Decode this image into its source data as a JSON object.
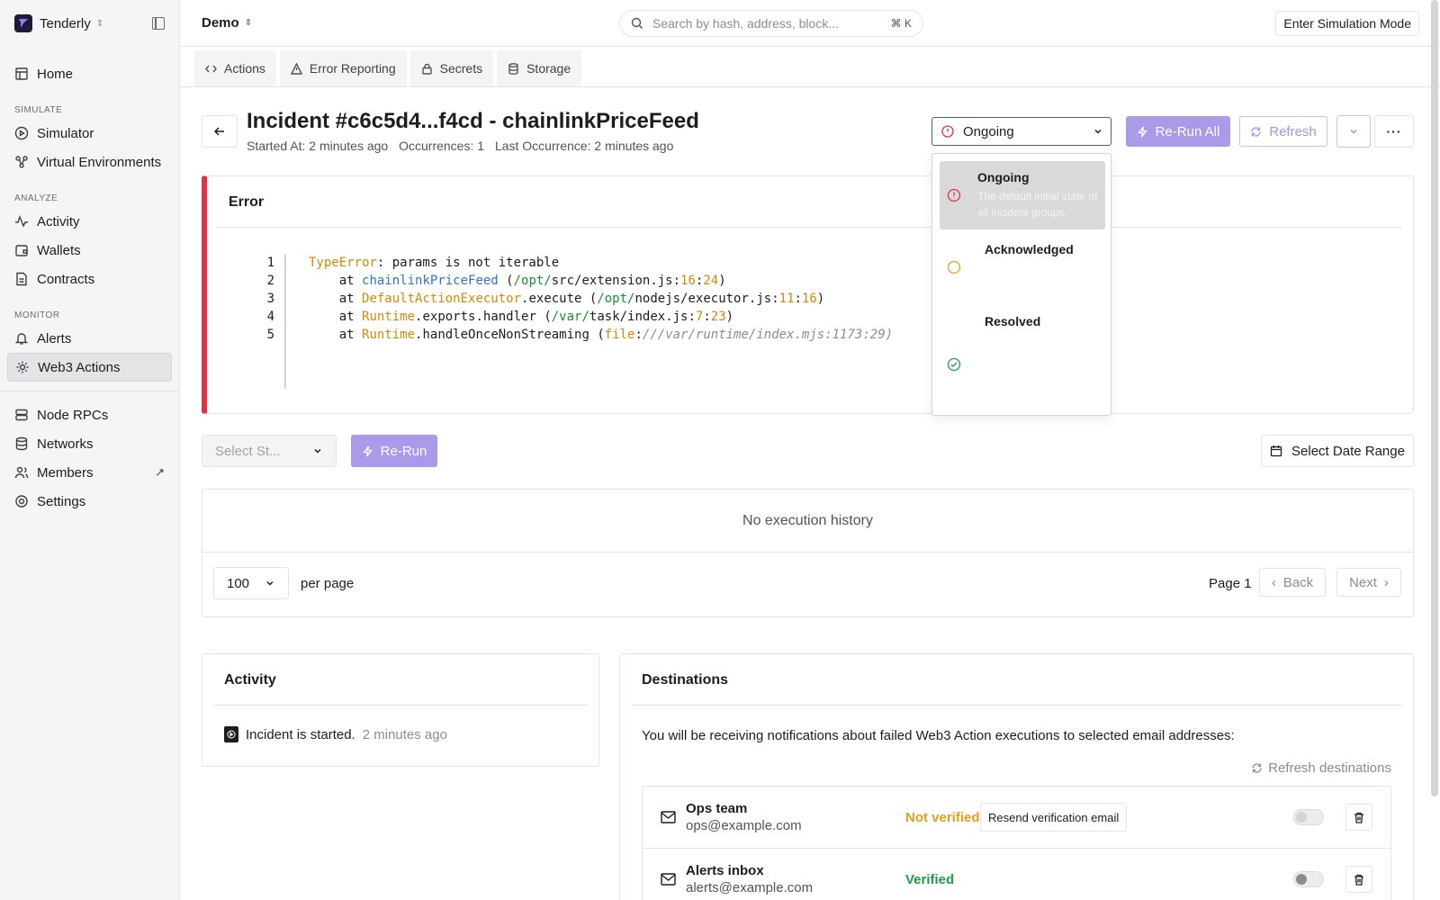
{
  "sidebar": {
    "org": "Tenderly",
    "items_top": [
      {
        "label": "Home"
      }
    ],
    "sections": [
      {
        "title": "SIMULATE",
        "items": [
          {
            "label": "Simulator"
          },
          {
            "label": "Virtual Environments"
          }
        ]
      },
      {
        "title": "ANALYZE",
        "items": [
          {
            "label": "Activity"
          },
          {
            "label": "Wallets"
          },
          {
            "label": "Contracts"
          }
        ]
      },
      {
        "title": "MONITOR",
        "items": [
          {
            "label": "Alerts"
          },
          {
            "label": "Web3 Actions"
          }
        ]
      }
    ],
    "items_bottom": [
      {
        "label": "Node RPCs"
      },
      {
        "label": "Networks"
      },
      {
        "label": "Members"
      },
      {
        "label": "Settings"
      }
    ],
    "active": "Web3 Actions"
  },
  "header": {
    "project": "Demo",
    "search_placeholder": "Search by hash, address, block...",
    "search_shortcut": "⌘ K",
    "simulation_button": "Enter Simulation Mode"
  },
  "tabs": [
    {
      "label": "Actions",
      "icon": "code-icon"
    },
    {
      "label": "Error Reporting",
      "icon": "warning-icon"
    },
    {
      "label": "Secrets",
      "icon": "lock-icon"
    },
    {
      "label": "Storage",
      "icon": "database-icon"
    }
  ],
  "incident": {
    "title": "Incident #c6c5d4...f4cd - chainlinkPriceFeed",
    "started_at": "Started At: 2 minutes ago",
    "occurrences": "Occurrences: 1",
    "last_occurrence": "Last Occurrence: 2 minutes ago",
    "status": "Ongoing",
    "rerun_all": "Re-Run All",
    "refresh": "Refresh"
  },
  "status_menu": [
    {
      "title": "Ongoing",
      "desc": "The default initial state of all incident groups.",
      "selected": true
    },
    {
      "title": "Acknowledged",
      "desc": "",
      "selected": false
    },
    {
      "title": "Resolved",
      "desc": "",
      "selected": false
    }
  ],
  "error": {
    "title": "Error",
    "lines": [
      "1",
      "2",
      "3",
      "4",
      "5"
    ]
  },
  "controls": {
    "select_status_placeholder": "Select St...",
    "rerun": "Re-Run",
    "date_range": "Select Date Range"
  },
  "history": {
    "empty": "No execution history",
    "per_page_value": "100",
    "per_page_label": "per page",
    "page": "Page 1",
    "back": "Back",
    "next": "Next"
  },
  "activity": {
    "title": "Activity",
    "entries": [
      {
        "text": "Incident is started.",
        "time": "2 minutes ago"
      }
    ]
  },
  "destinations": {
    "title": "Destinations",
    "description": "You will be receiving notifications about failed Web3 Action executions to selected email addresses:",
    "refresh": "Refresh destinations",
    "items": [
      {
        "name": "Ops team",
        "email": "ops@example.com",
        "status": "Not verified",
        "action": "Resend verification email"
      },
      {
        "name": "Alerts inbox",
        "email": "alerts@example.com",
        "status": "Verified",
        "action": ""
      }
    ]
  },
  "colors": {
    "accent": "#aa9ae9",
    "error": "#dc3545",
    "warning": "#e0a21b",
    "success": "#1f9a4a"
  }
}
